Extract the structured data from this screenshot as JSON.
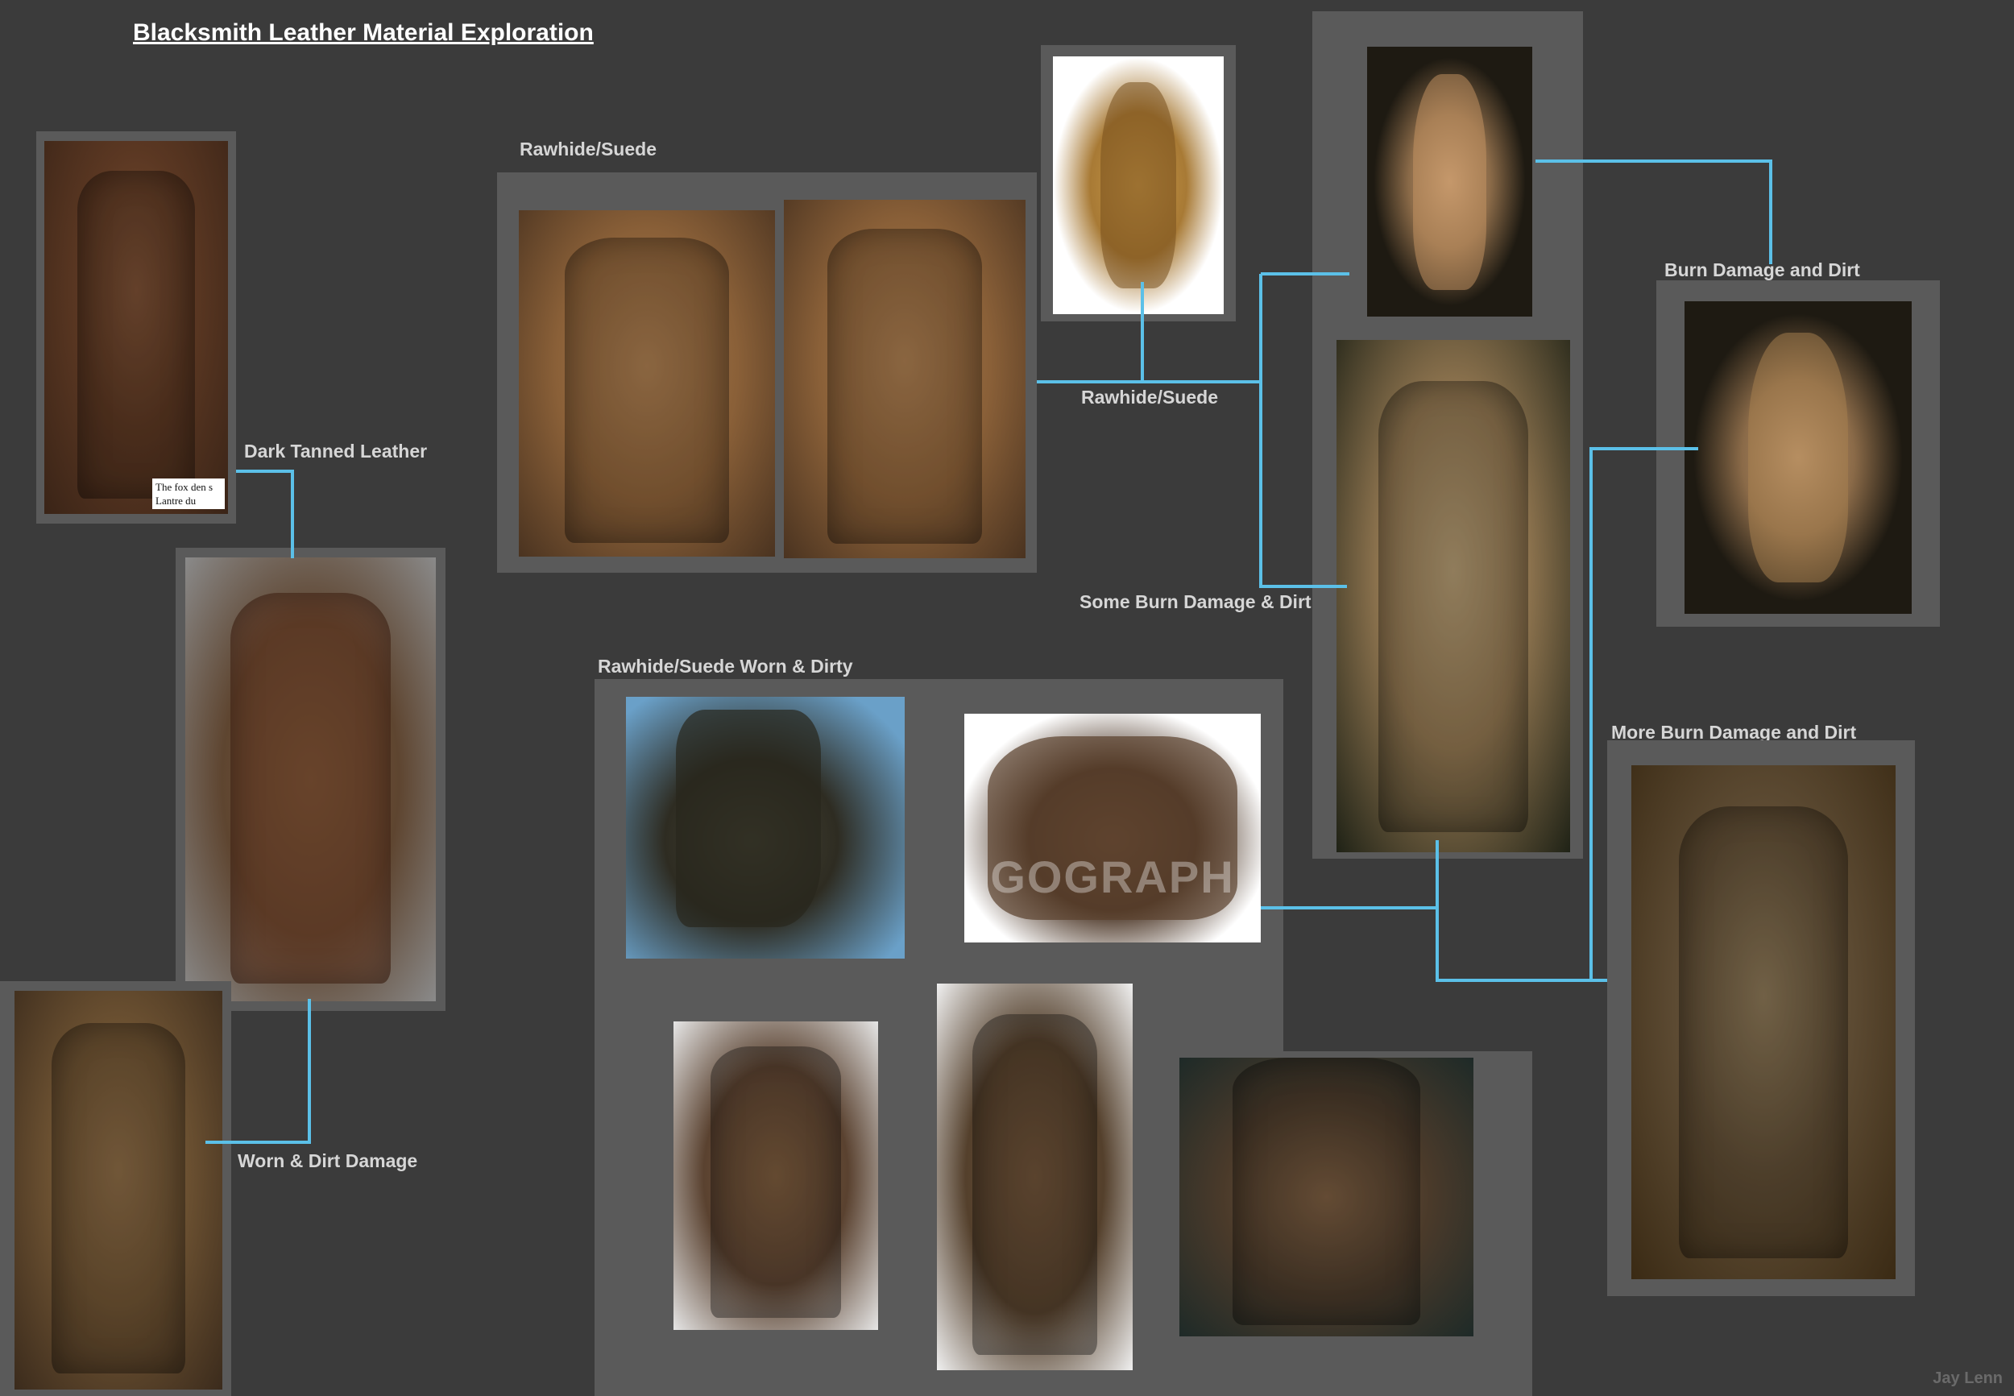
{
  "title": "Blacksmith Leather Material Exploration",
  "labels": {
    "dark_tanned": "Dark Tanned Leather",
    "worn_dirt": "Worn & Dirt Damage",
    "rawhide_top": "Rawhide/Suede",
    "rawhide_mid": "Rawhide/Suede",
    "rawhide_worn": "Rawhide/Suede Worn & Dirty",
    "some_burn": "Some Burn Damage & Dirt",
    "burn_dirt": "Burn Damage and Dirt",
    "more_burn": "More Burn Damage and Dirt"
  },
  "photo_text": {
    "book_caption": "The fox den s\nLantre du",
    "watermark": "GOGRAPH"
  },
  "credit": "Jay Lenn",
  "colors": {
    "background": "#3b3b3b",
    "panel": "#5a5a5a",
    "connector": "#5bc0e8"
  }
}
